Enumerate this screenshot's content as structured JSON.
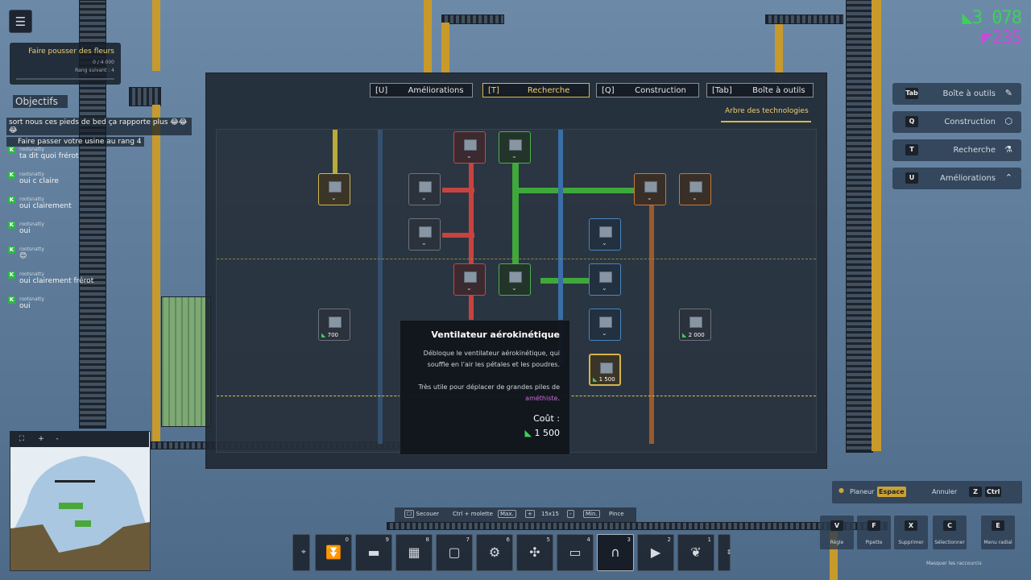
{
  "hud": {
    "menu_icon": "hamburger-icon",
    "objective": {
      "title": "Faire pousser des fleurs",
      "progress": "0 / 4 000",
      "next_rank": "Rang suivant : 4",
      "progress_fraction": 0
    },
    "objectives_label": "Objectifs",
    "chat": [
      {
        "user": "",
        "msg": "sort nous ces pieds de bed ça rapporte plus 😂😂😂"
      },
      {
        "user": "",
        "msg": "Faire passer votre usine au rang 4"
      },
      {
        "user": "rootsnatty",
        "msg": "ta dit quoi frérot"
      },
      {
        "user": "rootsnatty",
        "msg": "oui c claire"
      },
      {
        "user": "rootsnatty",
        "msg": "oui clairement"
      },
      {
        "user": "rootsnatty",
        "msg": "oui"
      },
      {
        "user": "rootsnatty",
        "msg": "😊"
      },
      {
        "user": "rootsnatty",
        "msg": "oui clairement frérot"
      },
      {
        "user": "rootsnatty",
        "msg": "oui"
      }
    ],
    "currency": {
      "green": "3 078",
      "purple": "235",
      "green_color": "#3fd05a",
      "purple_color": "#c74bd9"
    }
  },
  "side_menu": [
    {
      "label": "Boîte à outils",
      "key": "Tab",
      "icon": "wrench-icon"
    },
    {
      "label": "Construction",
      "key": "Q",
      "icon": "cube-icon"
    },
    {
      "label": "Recherche",
      "key": "T",
      "icon": "flask-icon"
    },
    {
      "label": "Améliorations",
      "key": "U",
      "icon": "chevrons-up-icon"
    }
  ],
  "modal": {
    "tabs": [
      {
        "label": "Boîte à outils",
        "key": "[Tab]"
      },
      {
        "label": "Construction",
        "key": "[Q]"
      },
      {
        "label": "Recherche",
        "key": "[T]",
        "active": true
      },
      {
        "label": "Améliorations",
        "key": "[U]"
      }
    ],
    "subtitle": "Arbre des technologies",
    "nodes_costs": {
      "left": "700",
      "right": "2 000",
      "selected": "1 500"
    }
  },
  "tooltip": {
    "title": "Ventilateur aérokinétique",
    "desc1": "Débloque le ventilateur aérokinétique, qui souffle en l'air les pétales et les poudres.",
    "desc2_prefix": "Très utile pour déplacer de grandes piles de ",
    "desc2_highlight": "améthiste",
    "desc2_suffix": ".",
    "cost_label": "Coût :",
    "cost_value": "1 500"
  },
  "hint_bar": {
    "pince": "Pince",
    "min": "Min.",
    "minus": "-",
    "size": "15x15",
    "plus": "+",
    "max": "Max.",
    "ctrl_molette": "Ctrl + molette",
    "secouer": "Secouer"
  },
  "hotbar": [
    {
      "num": "0",
      "icon": "funnel-icon"
    },
    {
      "num": "9",
      "icon": "conveyor-icon"
    },
    {
      "num": "8",
      "icon": "press-icon"
    },
    {
      "num": "7",
      "icon": "box-icon"
    },
    {
      "num": "6",
      "icon": "grinder-icon"
    },
    {
      "num": "5",
      "icon": "fan-icon"
    },
    {
      "num": "4",
      "icon": "belt-icon"
    },
    {
      "num": "3",
      "icon": "magnet-icon"
    },
    {
      "num": "2",
      "icon": "sprayer-icon"
    },
    {
      "num": "1",
      "icon": "seed-icon"
    }
  ],
  "shortcuts": {
    "ctrl": "Ctrl",
    "z": "Z",
    "annuler": "Annuler",
    "espace": "Espace",
    "planeur": "Planeur",
    "tools": [
      {
        "key": "E",
        "label": "Menu radial"
      },
      {
        "key": "C",
        "label": "Sélectionner"
      },
      {
        "key": "X",
        "label": "Supprimer"
      },
      {
        "key": "F",
        "label": "Pipette"
      },
      {
        "key": "V",
        "label": "Règle"
      }
    ],
    "hide": "Masquer les raccourcis"
  },
  "minimap": {
    "buttons": [
      "⛶",
      "+",
      "-"
    ]
  }
}
